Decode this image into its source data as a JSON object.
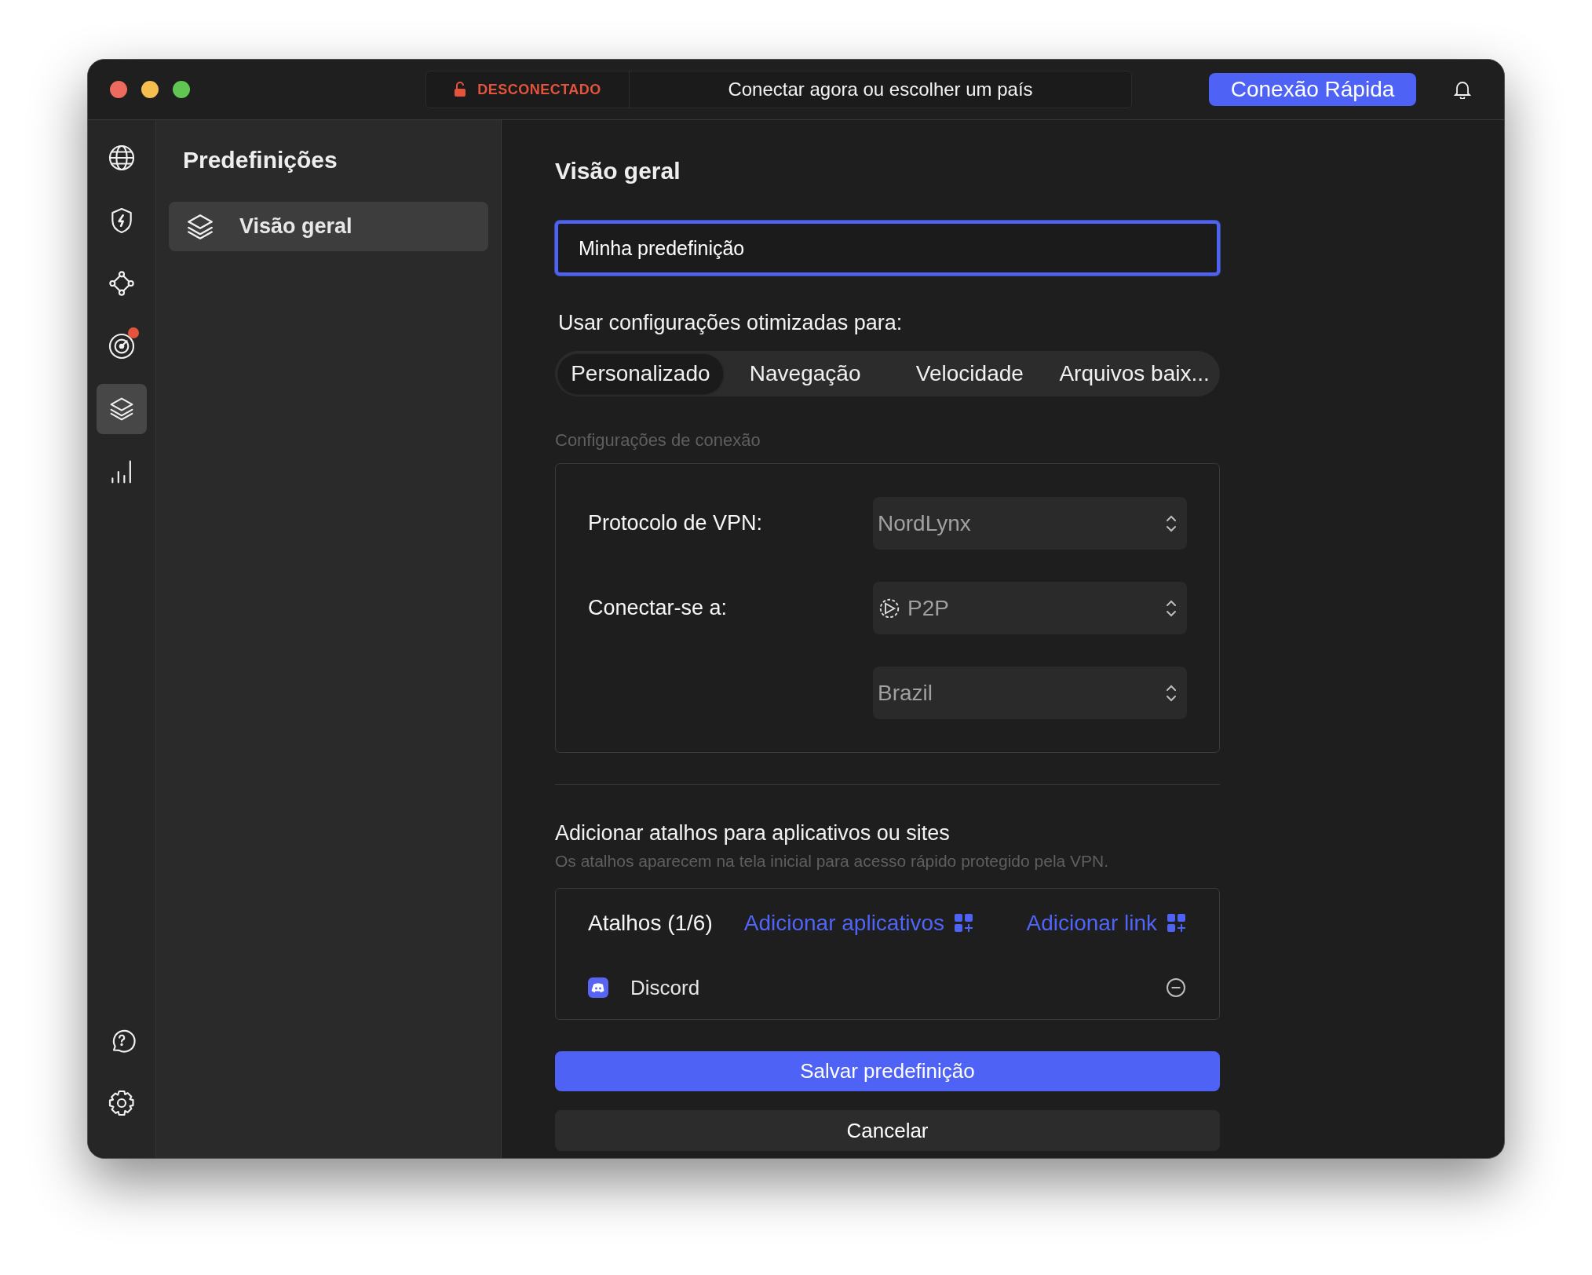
{
  "title_bar": {
    "status": "DESCONECTADO",
    "connect_prompt": "Conectar agora ou escolher um país",
    "quick_connect": "Conexão Rápida"
  },
  "nav_rail": {
    "items": [
      {
        "kind": "globe",
        "selected": false,
        "notification": false
      },
      {
        "kind": "shield",
        "selected": false,
        "notification": false
      },
      {
        "kind": "mesh",
        "selected": false,
        "notification": false
      },
      {
        "kind": "radar",
        "selected": false,
        "notification": true
      },
      {
        "kind": "layers",
        "selected": true,
        "notification": false
      },
      {
        "kind": "stats",
        "selected": false,
        "notification": false
      }
    ],
    "bottom_items": [
      {
        "kind": "help",
        "selected": false,
        "notification": false
      },
      {
        "kind": "settings",
        "selected": false,
        "notification": false
      }
    ]
  },
  "presets_panel": {
    "title": "Predefinições",
    "items": [
      {
        "label": "Visão geral",
        "selected": true
      }
    ]
  },
  "main": {
    "heading": "Visão geral",
    "name_field": {
      "value": "Minha predefinição"
    },
    "optimize_label": "Usar configurações otimizadas para:",
    "segments": [
      {
        "label": "Personalizado",
        "selected": true
      },
      {
        "label": "Navegação",
        "selected": false
      },
      {
        "label": "Velocidade",
        "selected": false
      },
      {
        "label": "Arquivos baix...",
        "selected": false
      }
    ],
    "connection": {
      "title": "Configurações de conexão",
      "rows": [
        {
          "kind": "plain",
          "label": "Protocolo de VPN:",
          "value": "NordLynx"
        },
        {
          "kind": "icon",
          "label": "Conectar-se a:",
          "value": "P2P"
        },
        {
          "kind": "plain",
          "value": "Brazil"
        }
      ]
    },
    "shortcuts": {
      "title": "Adicionar atalhos para aplicativos ou sites",
      "subtitle": "Os atalhos aparecem na tela inicial para acesso rápido protegido pela VPN.",
      "count_label": "Atalhos (1/6)",
      "actions": [
        "Adicionar aplicativos",
        "Adicionar link"
      ],
      "items": [
        {
          "name": "Discord"
        }
      ]
    },
    "buttons": {
      "save": "Salvar predefinição",
      "cancel": "Cancelar"
    }
  }
}
